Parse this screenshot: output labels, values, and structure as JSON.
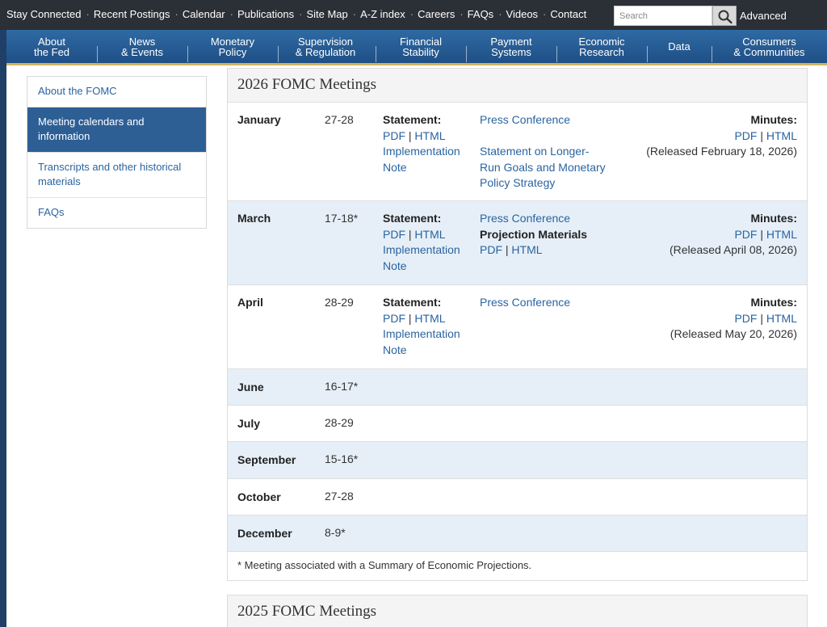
{
  "utility": {
    "links": [
      "Stay Connected",
      "Recent Postings",
      "Calendar",
      "Publications",
      "Site Map",
      "A-Z index",
      "Careers",
      "FAQs",
      "Videos",
      "Contact"
    ],
    "search_placeholder": "Search",
    "advanced": "Advanced"
  },
  "nav": [
    "About\nthe Fed",
    "News\n& Events",
    "Monetary\nPolicy",
    "Supervision\n& Regulation",
    "Financial\nStability",
    "Payment\nSystems",
    "Economic\nResearch",
    "Data",
    "Consumers\n& Communities"
  ],
  "sidebar": [
    {
      "label": "About the FOMC",
      "active": false
    },
    {
      "label": "Meeting calendars and information",
      "active": true
    },
    {
      "label": "Transcripts and other historical materials",
      "active": false
    },
    {
      "label": "FAQs",
      "active": false
    }
  ],
  "meetings_2026": {
    "title": "2026 FOMC Meetings",
    "labels": {
      "statement": "Statement:",
      "pdf": "PDF",
      "html": "HTML",
      "sep": "|",
      "implementation": "Implementation",
      "note": "Note",
      "press_conference": "Press Conference",
      "minutes": "Minutes:",
      "projection": "Projection Materials",
      "longer_run_1": "Statement on Longer-",
      "longer_run_2": "Run Goals and Monetary",
      "longer_run_3": "Policy Strategy"
    },
    "rows": [
      {
        "month": "January",
        "dates": "27-28",
        "released": "(Released February 18, 2026)"
      },
      {
        "month": "March",
        "dates": "17-18*",
        "released": "(Released April 08, 2026)"
      },
      {
        "month": "April",
        "dates": "28-29",
        "released": "(Released May 20, 2026)"
      },
      {
        "month": "June",
        "dates": "16-17*"
      },
      {
        "month": "July",
        "dates": "28-29"
      },
      {
        "month": "September",
        "dates": "15-16*"
      },
      {
        "month": "October",
        "dates": "27-28"
      },
      {
        "month": "December",
        "dates": "8-9*"
      }
    ],
    "footnote": "* Meeting associated with a Summary of Economic Projections."
  },
  "meetings_2025": {
    "title": "2025 FOMC Meetings"
  }
}
